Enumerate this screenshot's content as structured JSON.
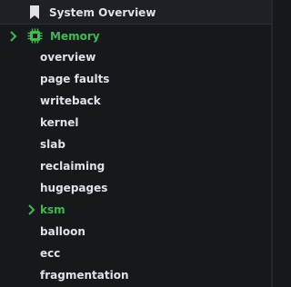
{
  "header": {
    "title": "System Overview",
    "icon": "bookmark-icon"
  },
  "memory": {
    "label": "Memory",
    "icon": "chip-icon",
    "expanded": true,
    "accent": "#3fb950"
  },
  "items": [
    {
      "label": "overview"
    },
    {
      "label": "page faults"
    },
    {
      "label": "writeback"
    },
    {
      "label": "kernel"
    },
    {
      "label": "slab"
    },
    {
      "label": "reclaiming"
    },
    {
      "label": "hugepages"
    },
    {
      "label": "ksm",
      "active": true
    },
    {
      "label": "balloon"
    },
    {
      "label": "ecc"
    },
    {
      "label": "fragmentation"
    }
  ]
}
